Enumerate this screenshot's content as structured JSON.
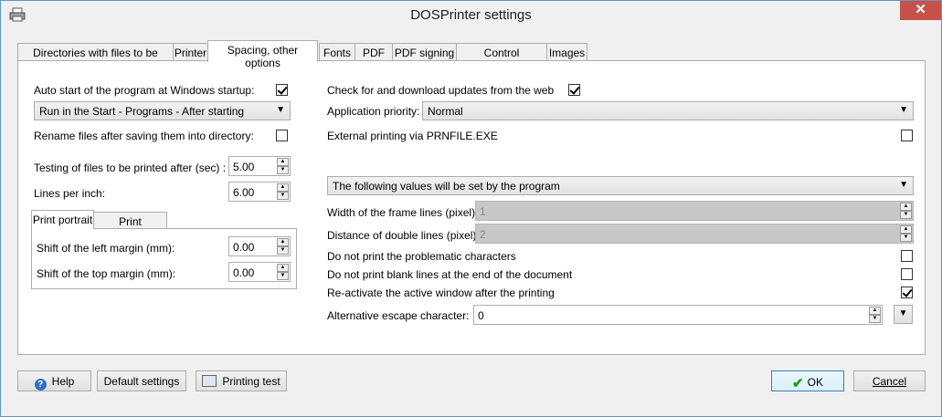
{
  "window": {
    "title": "DOSPrinter settings",
    "close_symbol": "✕"
  },
  "tabs": [
    "Directories with files to be printed",
    "Printer",
    "Spacing, other options",
    "Fonts",
    "PDF",
    "PDF signing",
    "Control sequences",
    "Images"
  ],
  "left": {
    "autostart_label": "Auto start of the program at Windows startup:",
    "autostart_checked": true,
    "run_mode": "Run in the Start - Programs - After starting",
    "rename_label": "Rename files after saving them into directory:",
    "rename_checked": false,
    "testing_label": "Testing of files to be printed after (sec) :",
    "testing_value": "5.00",
    "lpi_label": "Lines per inch:",
    "lpi_value": "6.00",
    "subtabs": [
      "Print portrait",
      "Print landscape"
    ],
    "left_margin_label": "Shift of the left margin (mm):",
    "left_margin_value": "0.00",
    "top_margin_label": "Shift of the top margin (mm):",
    "top_margin_value": "0.00"
  },
  "right": {
    "updates_label": "Check for and download updates from the web",
    "updates_checked": true,
    "priority_label": "Application priority:",
    "priority_value": "Normal",
    "external_label": "External printing via PRNFILE.EXE",
    "external_checked": false,
    "values_mode": "The following values will be set by the program",
    "frame_label": "Width of the frame lines (pixel):",
    "frame_value": "1",
    "double_label": "Distance of double lines (pixel):",
    "double_value": "2",
    "problematic_label": "Do not print the problematic characters",
    "problematic_checked": false,
    "blank_label": "Do not print blank lines at the end of the document",
    "blank_checked": false,
    "reactivate_label": "Re-activate the active window after the printing",
    "reactivate_checked": true,
    "escape_label": "Alternative escape character:",
    "escape_value": "0"
  },
  "buttons": {
    "help": "Help",
    "default": "Default settings",
    "test": "Printing test",
    "ok": "OK",
    "cancel": "Cancel"
  },
  "icons": [
    "printer-icon",
    "help-icon",
    "check-icon",
    "close-icon",
    "chevron-down-icon"
  ]
}
